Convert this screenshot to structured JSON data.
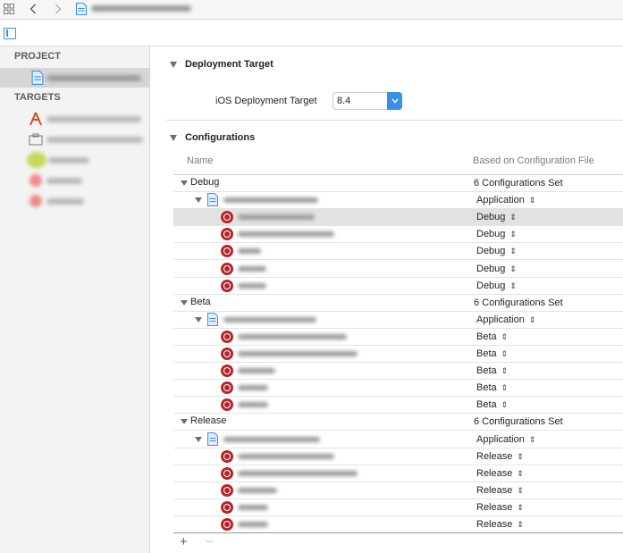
{
  "sidebar": {
    "project_header": "PROJECT",
    "targets_header": "TARGETS"
  },
  "deployment": {
    "title": "Deployment Target",
    "label": "iOS Deployment Target",
    "value": "8.4"
  },
  "configurations": {
    "title": "Configurations",
    "col_name": "Name",
    "col_based_on": "Based on Configuration File",
    "groups": [
      {
        "name": "Debug",
        "summary": "6 Configurations Set",
        "project_value": "Application",
        "target_values": [
          "Debug",
          "Debug",
          "Debug",
          "Debug",
          "Debug"
        ]
      },
      {
        "name": "Beta",
        "summary": "6 Configurations Set",
        "project_value": "Application",
        "target_values": [
          "Beta",
          "Beta",
          "Beta",
          "Beta",
          "Beta"
        ]
      },
      {
        "name": "Release",
        "summary": "6 Configurations Set",
        "project_value": "Application",
        "target_values": [
          "Release",
          "Release",
          "Release",
          "Release",
          "Release"
        ]
      }
    ]
  },
  "footer": {
    "add": "+",
    "remove": "−"
  },
  "colors": {
    "accent": "#3b8fe8",
    "target_icon": "#b3262a",
    "selection": "#e2e2e2"
  }
}
